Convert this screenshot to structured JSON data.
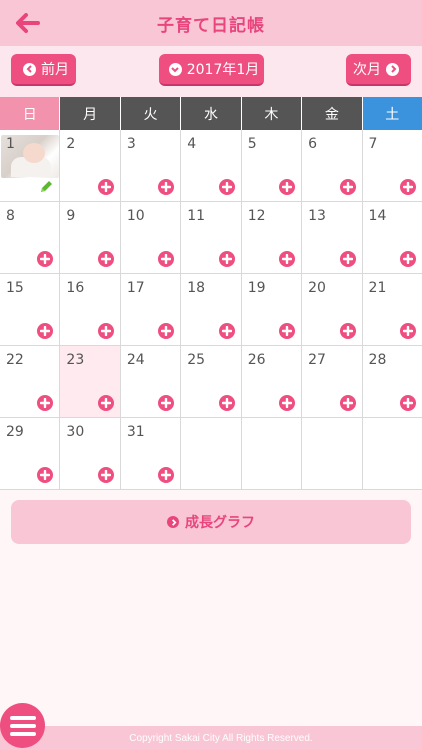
{
  "header": {
    "title": "子育て日記帳",
    "back_icon": "left-arrow-icon"
  },
  "nav": {
    "prev_label": "前月",
    "month_label": "2017年1月",
    "next_label": "次月"
  },
  "calendar": {
    "weekdays": [
      "日",
      "月",
      "火",
      "水",
      "木",
      "金",
      "土"
    ],
    "today": "23",
    "weeks": [
      [
        "1",
        "2",
        "3",
        "4",
        "5",
        "6",
        "7"
      ],
      [
        "8",
        "9",
        "10",
        "11",
        "12",
        "13",
        "14"
      ],
      [
        "15",
        "16",
        "17",
        "18",
        "19",
        "20",
        "21"
      ],
      [
        "22",
        "23",
        "24",
        "25",
        "26",
        "27",
        "28"
      ],
      [
        "29",
        "30",
        "31",
        "",
        "",
        "",
        ""
      ]
    ]
  },
  "graph_button": {
    "label": "成長グラフ"
  },
  "footer": {
    "copyright": "Copyright Sakai City All Rights Reserved."
  },
  "colors": {
    "accent": "#ee4f80",
    "header_bg": "#f9c6d6",
    "saturday": "#3c93dd",
    "sunday": "#f392ad"
  }
}
